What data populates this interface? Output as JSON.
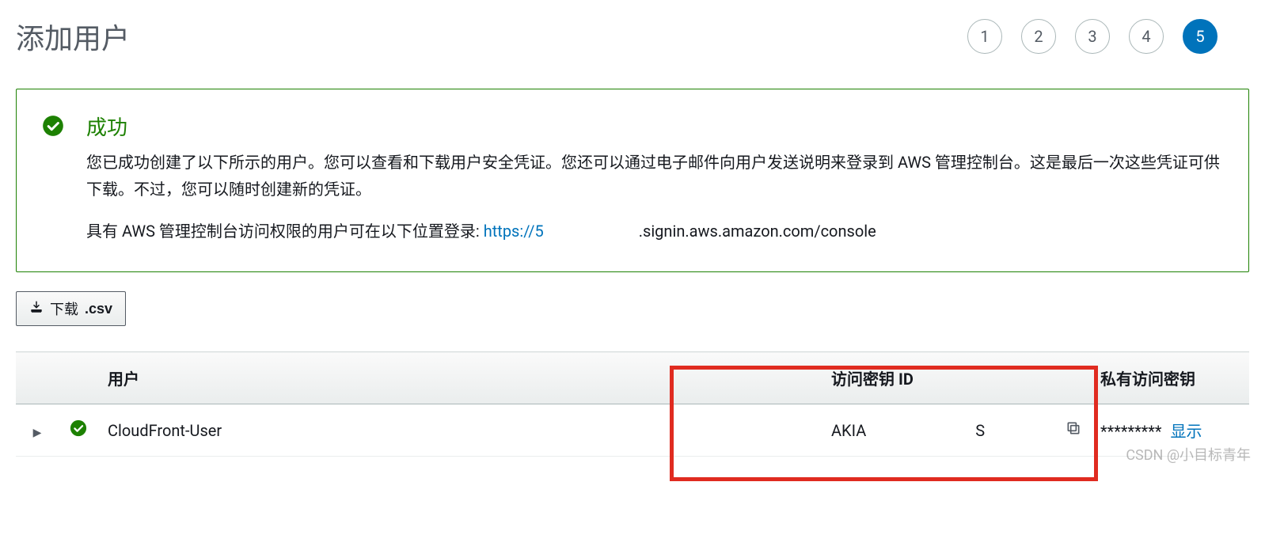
{
  "page": {
    "title": "添加用户"
  },
  "steps": {
    "labels": [
      "1",
      "2",
      "3",
      "4",
      "5"
    ],
    "active": 5
  },
  "success": {
    "title": "成功",
    "desc": "您已成功创建了以下所示的用户。您可以查看和下载用户安全凭证。您还可以通过电子邮件向用户发送说明来登录到 AWS 管理控制台。这是最后一次这些凭证可供下载。不过，您可以随时创建新的凭证。",
    "login_prefix": "具有 AWS 管理控制台访问权限的用户可在以下位置登录: ",
    "login_url_start": "https://5",
    "login_url_end": ".signin.aws.amazon.com/console"
  },
  "download": {
    "icon_label": "download-icon",
    "text": "下载",
    "ext": ".csv"
  },
  "table": {
    "headers": {
      "user": "用户",
      "access_key_id": "访问密钥 ID",
      "secret": "私有访问密钥"
    },
    "rows": [
      {
        "name": "CloudFront-User",
        "access_key_prefix": "AKIA",
        "access_key_suffix": "S",
        "secret_mask": "*********",
        "show_label": "显示"
      }
    ]
  },
  "watermark": "CSDN @小目标青年"
}
